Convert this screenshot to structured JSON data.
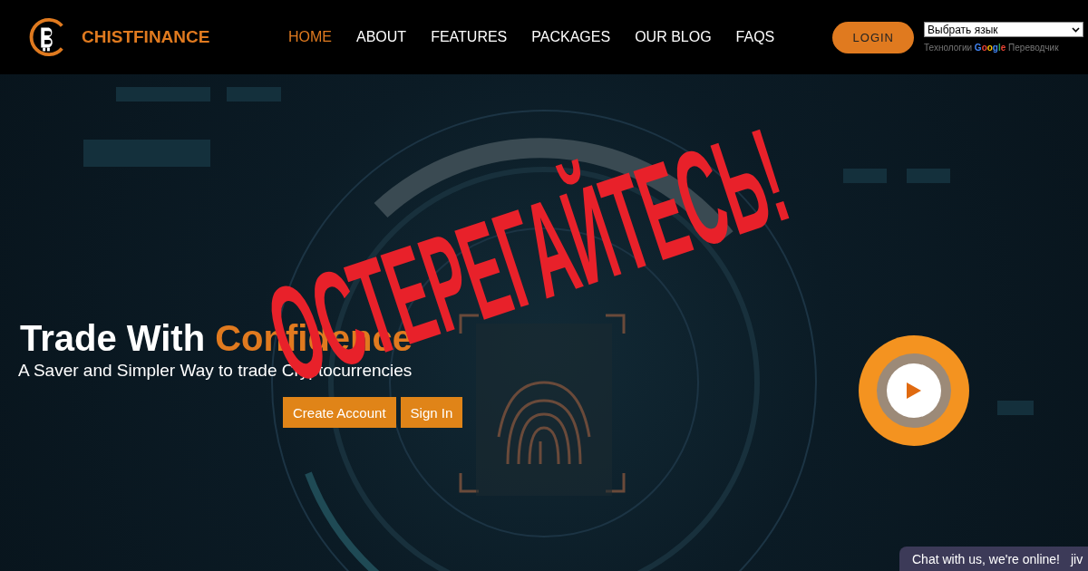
{
  "header": {
    "brand": "CHISTFINANCE",
    "nav": [
      {
        "label": "HOME",
        "selected": true
      },
      {
        "label": "ABOUT",
        "selected": false
      },
      {
        "label": "FEATURES",
        "selected": false
      },
      {
        "label": "PACKAGES",
        "selected": false
      },
      {
        "label": "OUR BLOG",
        "selected": false
      },
      {
        "label": "FAQS",
        "selected": false
      }
    ],
    "login_button": "LOGIN",
    "language_select": {
      "value": "Выбрать язык"
    },
    "translate_credit": {
      "prefix": "Технологии",
      "brand": "Google",
      "suffix": "Переводчик"
    }
  },
  "hero": {
    "title_start": "Trade With",
    "title_highlight": "Confidence",
    "subtitle": "A Saver and Simpler Way to trade Cryptocurrencies",
    "buttons": [
      "Create Account",
      "Sign In"
    ]
  },
  "warning_stamp": "ОСТЕРЕГАЙТЕСЬ!",
  "chat_widget": {
    "label": "Chat with us, we're online!",
    "brand": "jiv"
  }
}
